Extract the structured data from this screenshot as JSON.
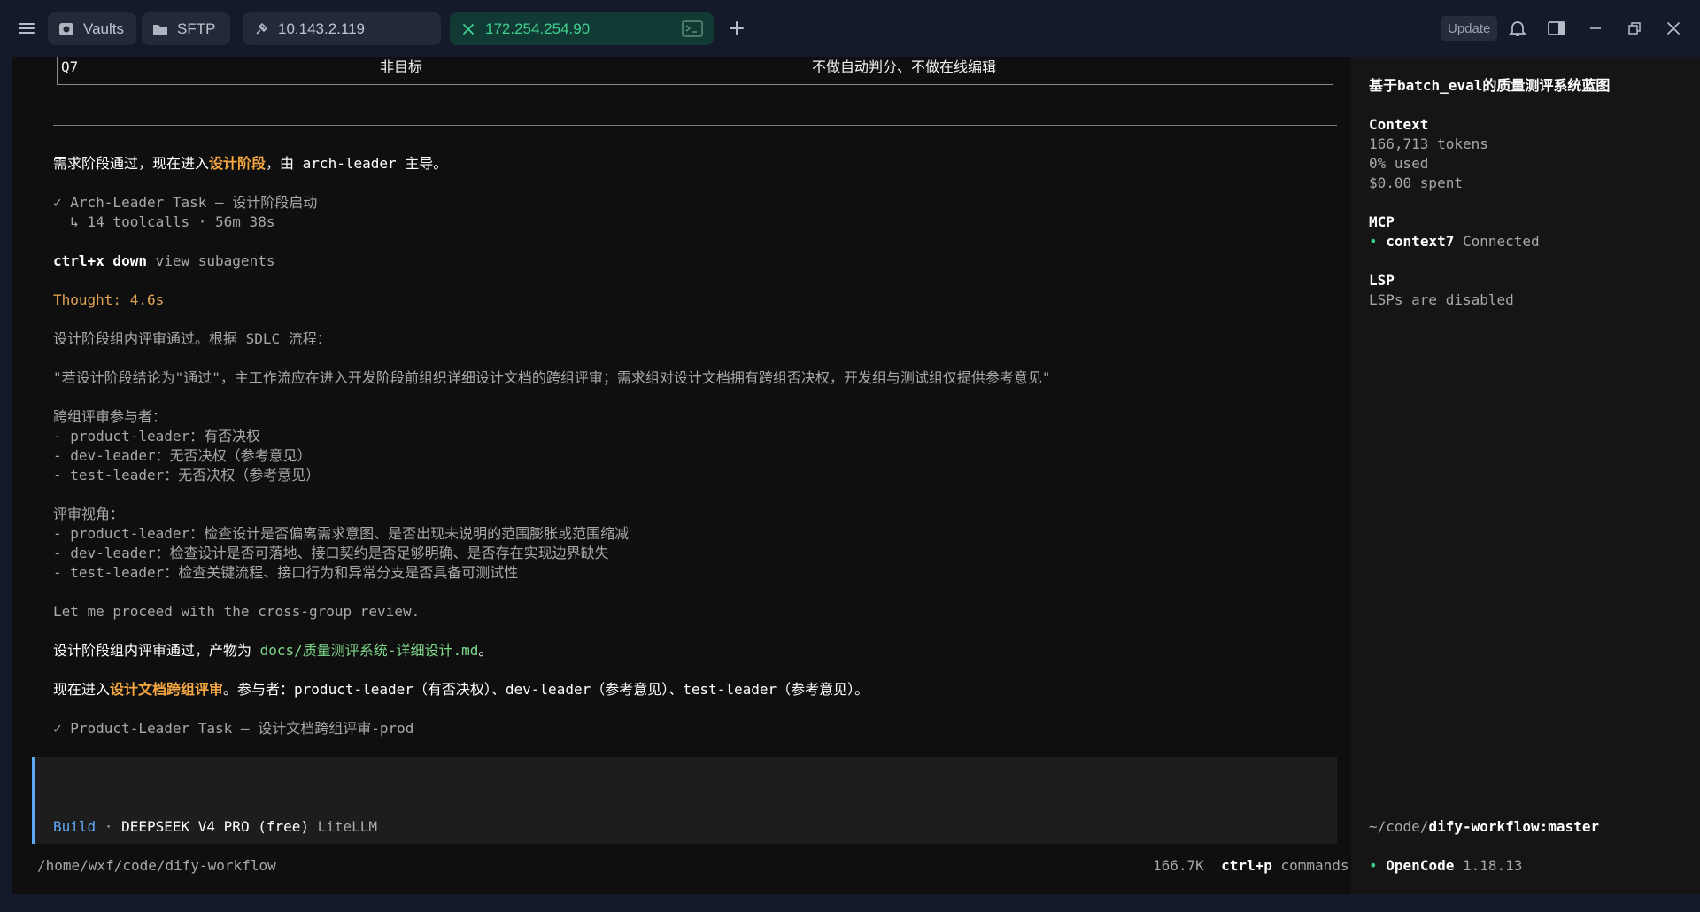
{
  "tabs": [
    {
      "label": "Vaults"
    },
    {
      "label": "SFTP"
    },
    {
      "label": "10.143.2.119"
    },
    {
      "label": "172.254.254.90"
    }
  ],
  "topbar": {
    "update_label": "Update"
  },
  "table": {
    "row": {
      "id": "Q7",
      "type": "非目标",
      "desc": "不做自动判分、不做在线编辑"
    }
  },
  "content": {
    "l1_a": "需求阶段通过，现在进入",
    "l1_b": "设计阶段",
    "l1_c": "，由 arch-leader 主导。",
    "task1": "✓ Arch-Leader Task — 设计阶段启动",
    "task1_meta": "  ↳ 14 toolcalls · 56m 38s",
    "ctrl_key": "ctrl+x down",
    "ctrl_desc": " view subagents",
    "thought": "Thought: 4.6s",
    "p1": "设计阶段组内评审通过。根据 SDLC 流程：",
    "p2": "\"若设计阶段结论为\"通过\"，主工作流应在进入开发阶段前组织详细设计文档的跨组评审；需求组对设计文档拥有跨组否决权，开发组与测试组仅提供参考意见\"",
    "p3_title": "跨组评审参与者：",
    "p3_items": [
      "- product-leader：有否决权",
      "- dev-leader：无否决权（参考意见）",
      "- test-leader：无否决权（参考意见）"
    ],
    "p4_title": "评审视角：",
    "p4_items": [
      "- product-leader：检查设计是否偏离需求意图、是否出现未说明的范围膨胀或范围缩减",
      "- dev-leader：检查设计是否可落地、接口契约是否足够明确、是否存在实现边界缺失",
      "- test-leader：检查关键流程、接口行为和异常分支是否具备可测试性"
    ],
    "p5": "Let me proceed with the cross-group review.",
    "p6_a": "设计阶段组内评审通过，产物为 ",
    "p6_b": "docs/质量测评系统-详细设计.md",
    "p6_c": "。",
    "p7_a": "现在进入",
    "p7_b": "设计文档跨组评审",
    "p7_c": "。参与者：product-leader（有否决权）、dev-leader（参考意见）、test-leader（参考意见）。",
    "task2": "✓ Product-Leader Task — 设计文档跨组评审-prod"
  },
  "input": {
    "mode": "Build",
    "sep": " · ",
    "model": "DEEPSEEK V4 PRO (free)",
    "provider": " LiteLLM"
  },
  "status": {
    "cwd": "/home/wxf/code/dify-workflow",
    "tokens": "166.7K",
    "cmd_key": "ctrl+p",
    "cmd_label": " commands"
  },
  "sidebar": {
    "title": "基于batch_eval的质量测评系统蓝图",
    "context_heading": "Context",
    "context_tokens": "166,713 tokens",
    "context_used": "0% used",
    "context_spent": "$0.00 spent",
    "mcp_heading": "MCP",
    "mcp_name": "context7",
    "mcp_status": " Connected",
    "lsp_heading": "LSP",
    "lsp_status": "LSPs are disabled",
    "path_prefix": "~/code/",
    "path_repo": "dify-workflow:master",
    "app_name": "OpenCode",
    "app_version": " 1.18.13"
  },
  "colors": {
    "accent_green": "#3ed08e",
    "accent_orange": "#f5a742",
    "accent_blue": "#5fa8f7"
  }
}
